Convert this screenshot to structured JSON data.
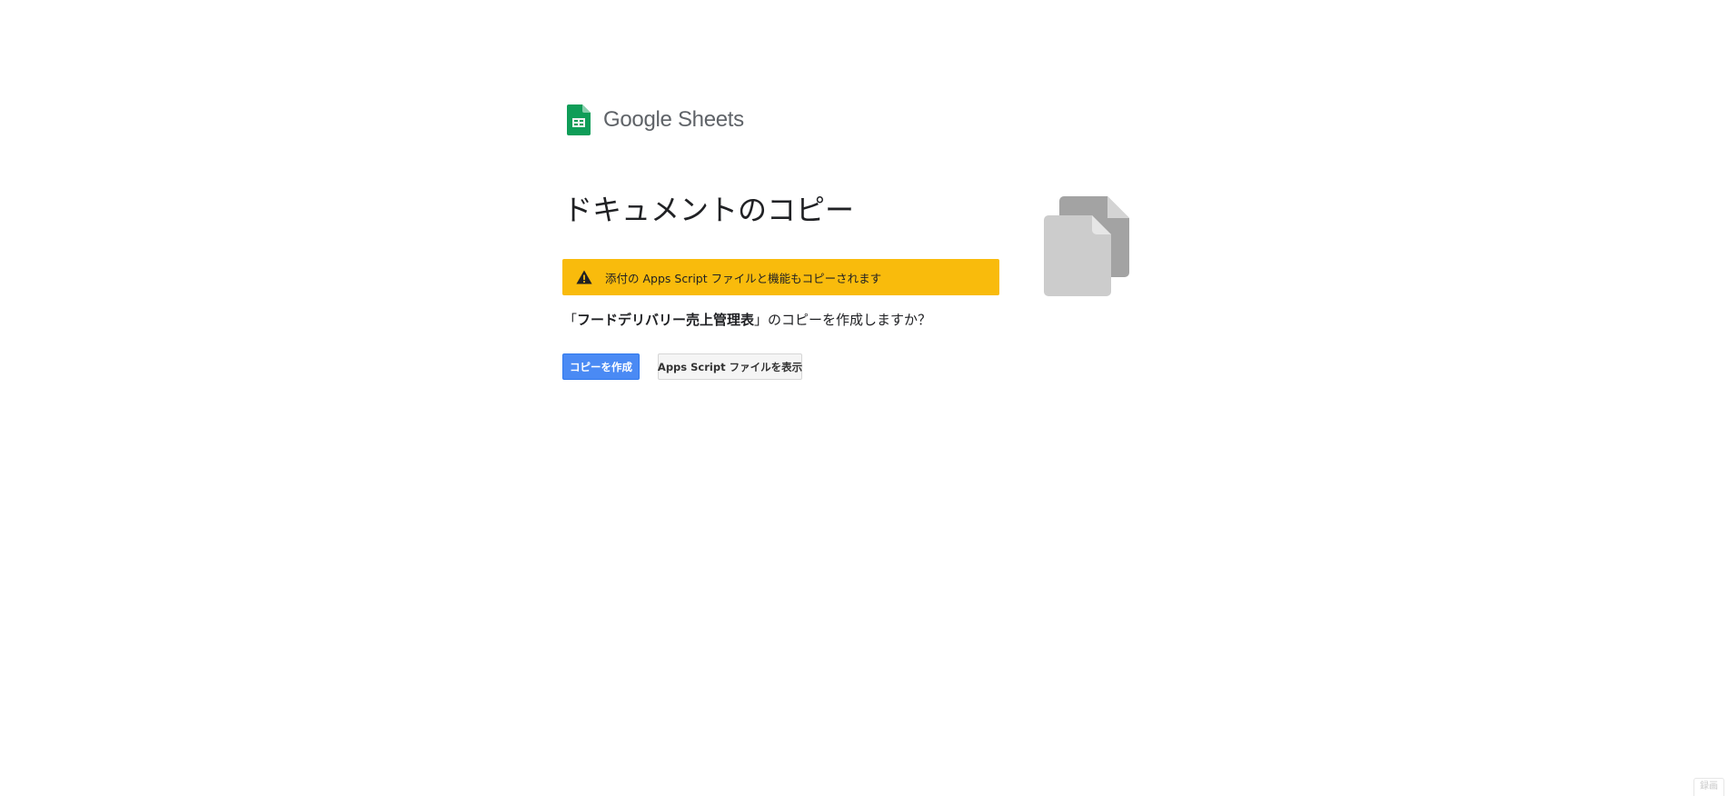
{
  "header": {
    "logo_text": "Google Sheets",
    "logo_icon": "sheets-icon",
    "brand_color": "#0f9d58"
  },
  "main": {
    "title": "ドキュメントのコピー",
    "warning": {
      "icon": "warning-icon",
      "text": "添付の Apps Script ファイルと機能もコピーされます",
      "color": "#f9bb0c"
    },
    "question": {
      "open_quote": "「",
      "doc_name": "フードデリバリー売上管理表",
      "rest": "」のコピーを作成しますか？"
    },
    "buttons": {
      "make_copy_label": "コピーを作成",
      "view_script_label": "Apps Script ファイルを表示",
      "primary_color": "#4a8af4"
    },
    "illustration_icon": "copy-documents-icon"
  },
  "corner_badge": {
    "label": "録画"
  }
}
